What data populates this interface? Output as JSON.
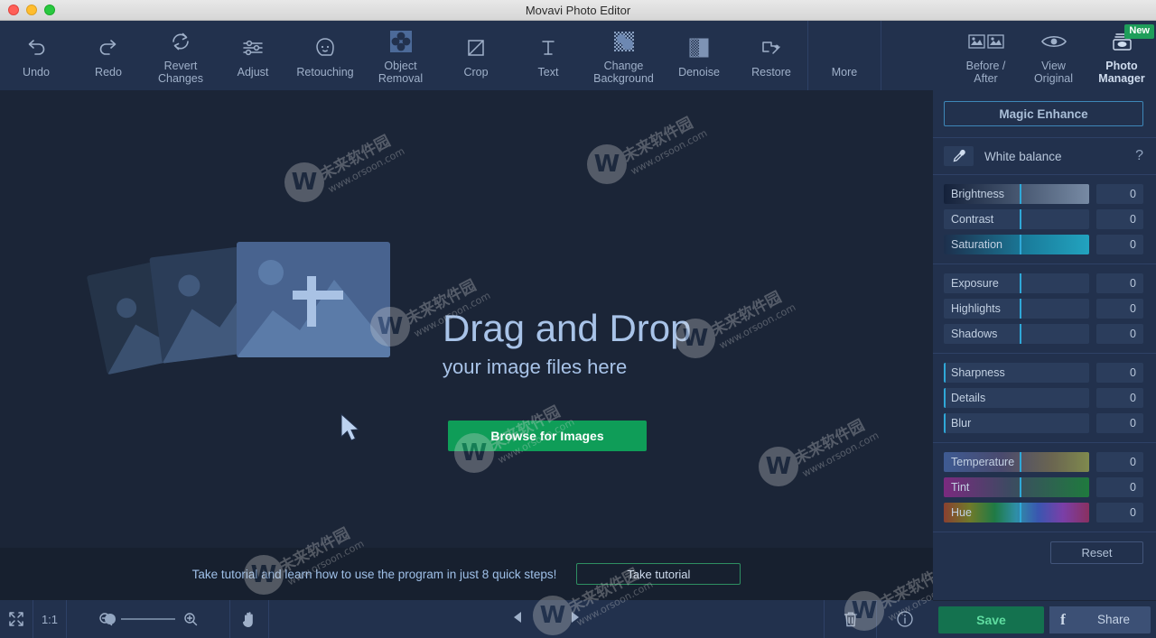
{
  "window": {
    "title": "Movavi Photo Editor",
    "traffic_lights": [
      "close",
      "minimize",
      "zoom"
    ]
  },
  "toolbar": {
    "items": [
      {
        "label": "Undo",
        "icon": "undo-icon"
      },
      {
        "label": "Redo",
        "icon": "redo-icon"
      },
      {
        "label": "Revert Changes",
        "icon": "revert-icon"
      },
      {
        "label": "Adjust",
        "icon": "sliders-icon"
      },
      {
        "label": "Retouching",
        "icon": "face-icon"
      },
      {
        "label": "Object Removal",
        "icon": "object-removal-icon"
      },
      {
        "label": "Crop",
        "icon": "crop-icon"
      },
      {
        "label": "Text",
        "icon": "text-icon"
      },
      {
        "label": "Change Background",
        "icon": "change-background-icon"
      },
      {
        "label": "Denoise",
        "icon": "denoise-icon"
      },
      {
        "label": "Restore",
        "icon": "restore-icon"
      },
      {
        "label": "More",
        "icon": "more-icon"
      }
    ],
    "right_items": [
      {
        "label": "Before / After",
        "icon": "before-after-icon"
      },
      {
        "label": "View Original",
        "icon": "eye-icon"
      },
      {
        "label": "Photo Manager",
        "icon": "photo-manager-icon",
        "badge": "New"
      }
    ]
  },
  "canvas": {
    "drop_title": "Drag and Drop",
    "drop_subtitle": "your image files here",
    "browse_label": "Browse for Images",
    "accent_green": "#0f9d58",
    "placeholder_color": "#48638f"
  },
  "tutorial": {
    "text": "Take tutorial and learn how to use the program in just 8 quick steps!",
    "button_label": "Take tutorial"
  },
  "bottombar": {
    "fit_icon": "fit-screen-icon",
    "actual_size": "1:1",
    "zoom_out_icon": "zoom-out-icon",
    "zoom_in_icon": "zoom-in-icon",
    "pan_icon": "hand-icon",
    "prev_icon": "previous-arrow-icon",
    "next_icon": "next-arrow-icon",
    "trash_icon": "trash-icon",
    "info_icon": "info-icon"
  },
  "panel": {
    "magic_enhance": "Magic Enhance",
    "white_balance": {
      "label": "White balance",
      "icon": "eyedropper-icon",
      "help": "?"
    },
    "groups": [
      {
        "sliders": [
          {
            "name": "Brightness",
            "value": "0",
            "gradient": "linear-gradient(to right,#14213a 0%,#778aa4 100%)"
          },
          {
            "name": "Contrast",
            "value": "0",
            "gradient": "none"
          },
          {
            "name": "Saturation",
            "value": "0",
            "gradient": "linear-gradient(to right,#1d2f4c 0%,#1a7f9e 60%,#22a3bf 100%)"
          }
        ]
      },
      {
        "sliders": [
          {
            "name": "Exposure",
            "value": "0",
            "gradient": "none"
          },
          {
            "name": "Highlights",
            "value": "0",
            "gradient": "none"
          },
          {
            "name": "Shadows",
            "value": "0",
            "gradient": "none"
          }
        ]
      },
      {
        "sliders": [
          {
            "name": "Sharpness",
            "value": "0",
            "gradient": "none",
            "flat": true
          },
          {
            "name": "Details",
            "value": "0",
            "gradient": "none",
            "flat": true
          },
          {
            "name": "Blur",
            "value": "0",
            "gradient": "none",
            "flat": true
          }
        ]
      },
      {
        "sliders": [
          {
            "name": "Temperature",
            "value": "0",
            "gradient": "linear-gradient(to right,#3e5b93 0%,#4a4a6e 40%,#6b6650 75%,#7f8a4e 100%)"
          },
          {
            "name": "Tint",
            "value": "0",
            "gradient": "linear-gradient(to right,#7a2a7f 0%,#3d4a62 45%,#1f7a3e 100%)"
          },
          {
            "name": "Hue",
            "value": "0",
            "gradient": "linear-gradient(to right,#8a4030 0%,#6f7a2a 18%,#1f7a45 35%,#2f8fa8 50%,#3a56b0 65%,#7a3fa8 82%,#8a3060 100%)"
          }
        ]
      }
    ],
    "reset_label": "Reset",
    "save_label": "Save",
    "share_label": "Share",
    "facebook_icon": "facebook-icon"
  },
  "watermark": {
    "line1": "未来软件园",
    "line2": "www.orsoon.com"
  }
}
